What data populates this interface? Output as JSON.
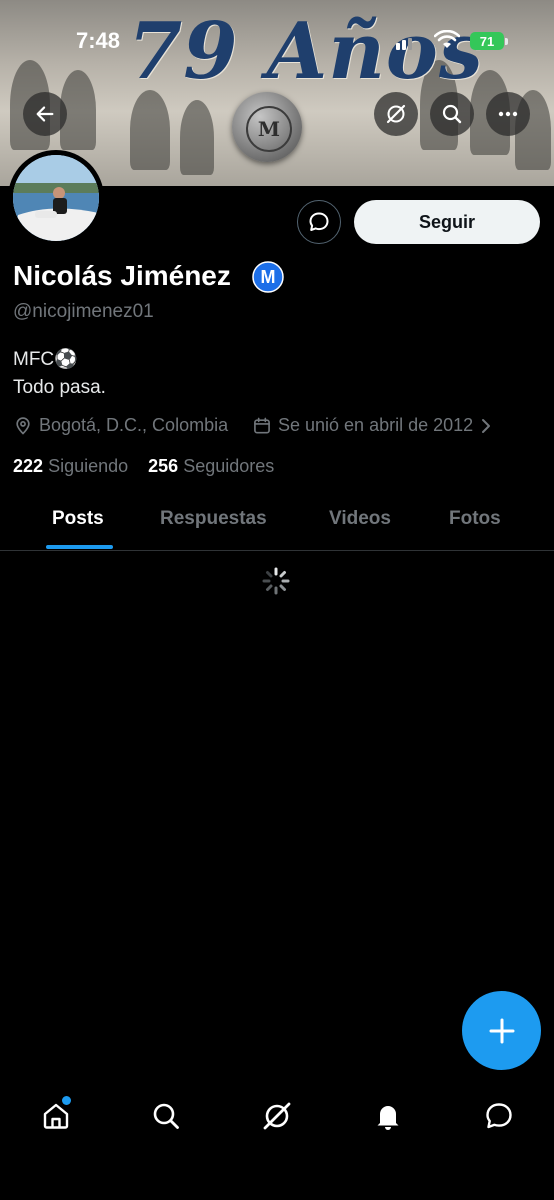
{
  "status_bar": {
    "time": "7:48",
    "battery": "71"
  },
  "banner": {
    "title": "79 Años",
    "seal_letter": "M"
  },
  "profile": {
    "name": "Nicolás Jiménez",
    "handle": "@nicojimenez01",
    "bio_line1": "MFC⚽",
    "bio_line2": "Todo pasa.",
    "location": "Bogotá, D.C., Colombia",
    "joined": "Se unió en abril de 2012",
    "following_count": "222",
    "following_label": "Siguiendo",
    "followers_count": "256",
    "followers_label": "Seguidores",
    "badge_letter": "M"
  },
  "actions": {
    "follow_label": "Seguir"
  },
  "tabs": [
    {
      "label": "Posts",
      "active": true
    },
    {
      "label": "Respuestas",
      "active": false
    },
    {
      "label": "Videos",
      "active": false
    },
    {
      "label": "Fotos",
      "active": false
    }
  ],
  "colors": {
    "accent": "#1d9bf0",
    "background": "#000000",
    "badge_blue": "#1d6fe8"
  },
  "icons": {
    "header": [
      "back-arrow-icon",
      "grok-icon",
      "search-icon",
      "more-icon"
    ],
    "nav": [
      "home-icon",
      "search-icon",
      "grok-icon",
      "notifications-icon",
      "messages-icon"
    ]
  }
}
